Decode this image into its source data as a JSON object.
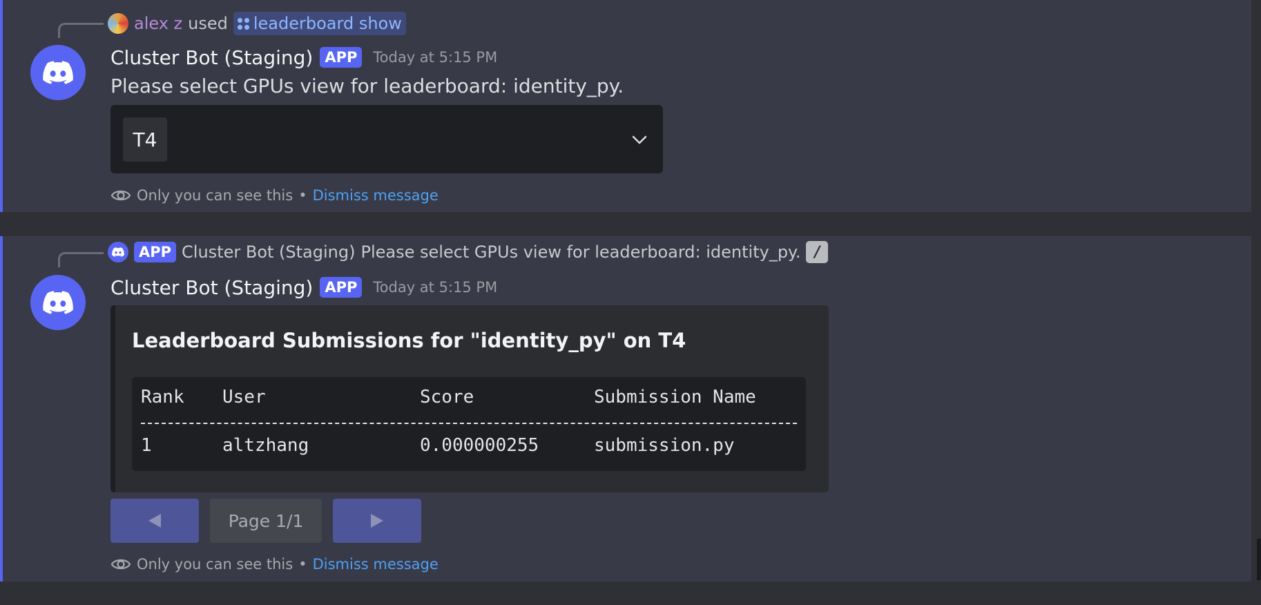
{
  "colors": {
    "background": "#2f3035",
    "message_highlight": "#393a47",
    "accent": "#5865f2",
    "link": "#4ea0f5",
    "button_primary": "#4e5599"
  },
  "message1": {
    "reply": {
      "user_name": "alex z",
      "used_text": "used",
      "command": "leaderboard show",
      "command_icon": "slash-command-icon"
    },
    "author": "Cluster Bot (Staging)",
    "badge": "APP",
    "timestamp": "Today at 5:15 PM",
    "text": "Please select GPUs view for leaderboard: identity_py.",
    "select": {
      "selected": "T4",
      "icon": "chevron-down-icon"
    },
    "ephemeral": {
      "note": "Only you can see this",
      "separator": "•",
      "dismiss": "Dismiss message"
    }
  },
  "message2": {
    "reply": {
      "badge": "APP",
      "author": "Cluster Bot (Staging)",
      "text": "Please select GPUs view for leaderboard: identity_py.",
      "icon": "slash-icon"
    },
    "author": "Cluster Bot (Staging)",
    "badge": "APP",
    "timestamp": "Today at 5:15 PM",
    "embed": {
      "title": "Leaderboard Submissions for \"identity_py\" on T4",
      "table": {
        "headers": [
          "Rank",
          "User",
          "Score",
          "Submission Name"
        ],
        "rows": [
          [
            "1",
            "altzhang",
            "0.000000255",
            "submission.py"
          ]
        ]
      }
    },
    "pagination": {
      "prev_icon": "triangle-left-icon",
      "page_label": "Page 1/1",
      "next_icon": "triangle-right-icon"
    },
    "ephemeral": {
      "note": "Only you can see this",
      "separator": "•",
      "dismiss": "Dismiss message"
    }
  }
}
